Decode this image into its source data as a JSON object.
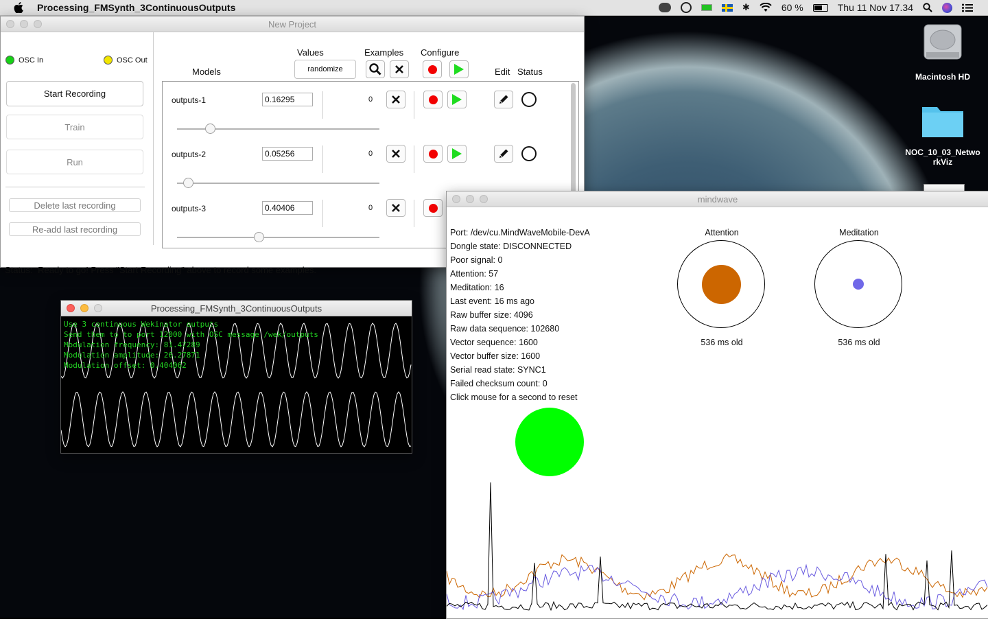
{
  "menubar": {
    "app_name": "Processing_FMSynth_3ContinuousOutputs",
    "battery": "60 %",
    "datetime": "Thu 11 Nov  17.34"
  },
  "desktop": {
    "icons": [
      {
        "label": "Macintosh HD"
      },
      {
        "label": "NOC_10_03_NetworkViz"
      }
    ]
  },
  "wekinator": {
    "title": "New Project",
    "osc_in": "OSC In",
    "osc_out": "OSC Out",
    "buttons": {
      "start_recording": "Start Recording",
      "train": "Train",
      "run": "Run",
      "delete_last": "Delete last recording",
      "readd_last": "Re-add last recording"
    },
    "headers": {
      "models": "Models",
      "values": "Values",
      "examples": "Examples",
      "configure": "Configure",
      "edit": "Edit",
      "status": "Status"
    },
    "randomize": "randomize",
    "models": [
      {
        "name": "outputs-1",
        "value": "0.16295",
        "count": "0",
        "slider": 0.163
      },
      {
        "name": "outputs-2",
        "value": "0.05256",
        "count": "0",
        "slider": 0.053
      },
      {
        "name": "outputs-3",
        "value": "0.40406",
        "count": "0",
        "slider": 0.404
      }
    ],
    "status_label": "Status:",
    "status_text": "Ready to go! Press \"Start Recording\" above to record some examples."
  },
  "synth": {
    "title": "Processing_FMSynth_3ContinuousOutputs",
    "lines": [
      "Use 3 continuous Wekinator outputs",
      "Send them to to port 12000 with OSC message /wek/outputs",
      "Modulation frequency: 81.47289",
      "Modulation amplitude: 26.27871",
      "Modulation offset: 0.404062"
    ]
  },
  "mindwave": {
    "title": "mindwave",
    "stats": [
      "Port: /dev/cu.MindWaveMobile-DevA",
      "Dongle state: DISCONNECTED",
      "Poor signal: 0",
      "Attention: 57",
      "Meditation: 16",
      "Last event: 16 ms ago",
      "Raw buffer size: 4096",
      "Raw data sequence: 102680",
      "Vector sequence: 1600",
      "Vector buffer size: 1600",
      "Serial read state: SYNC1",
      "Failed checksum count: 0",
      "Click mouse for a second to reset"
    ],
    "attention": {
      "label": "Attention",
      "age": "536 ms old",
      "color": "#cc6600",
      "value": 57
    },
    "meditation": {
      "label": "Meditation",
      "age": "536 ms old",
      "color": "#7068e8",
      "value": 16
    },
    "indicator_color": "#00ff00",
    "series_colors": {
      "raw": "#000000",
      "attention": "#cc6600",
      "meditation": "#6a5ce0"
    }
  }
}
